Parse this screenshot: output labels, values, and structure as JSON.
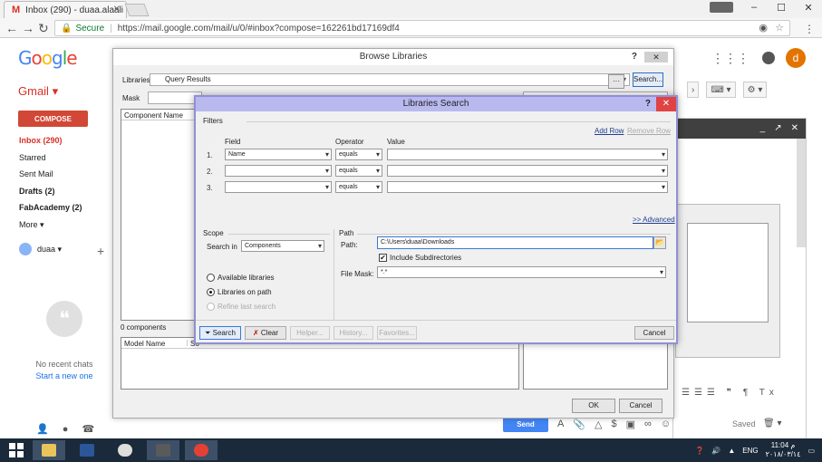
{
  "browser": {
    "tab_title": "Inbox (290) - duaa.alaali",
    "url": "https://mail.google.com/mail/u/0/#inbox?compose=162261bd17169df4",
    "secure_label": "Secure"
  },
  "gmail": {
    "logo_letters": [
      "G",
      "o",
      "o",
      "g",
      "l",
      "e"
    ],
    "product_label": "Gmail",
    "compose_label": "COMPOSE",
    "nav": [
      {
        "label": "Inbox (290)",
        "style": "active"
      },
      {
        "label": "Starred",
        "style": "normal"
      },
      {
        "label": "Sent Mail",
        "style": "normal"
      },
      {
        "label": "Drafts (2)",
        "style": "bold"
      },
      {
        "label": "FabAcademy (2)",
        "style": "bold"
      },
      {
        "label": "More",
        "style": "normal"
      }
    ],
    "user_name": "duaa",
    "avatar_letter": "d",
    "no_chats": "No recent chats",
    "start_chat": "Start a new one",
    "send_label": "Send",
    "saved_label": "Saved"
  },
  "browse": {
    "title": "Browse Libraries",
    "libraries_label": "Libraries",
    "libraries_value": "Query Results",
    "search_button": "Search...",
    "mask_label": "Mask",
    "component_name_header": "Component Name",
    "components_count": "0 components",
    "model_name_header": "Model Name",
    "model_source_header": "So",
    "ok_button": "OK",
    "cancel_button": "Cancel"
  },
  "search": {
    "title": "Libraries Search",
    "filters_label": "Filters",
    "add_row": "Add Row",
    "remove_row": "Remove Row",
    "field_header": "Field",
    "operator_header": "Operator",
    "value_header": "Value",
    "rows": [
      {
        "num": "1.",
        "field": "Name",
        "operator": "equals",
        "value": ""
      },
      {
        "num": "2.",
        "field": "",
        "operator": "equals",
        "value": ""
      },
      {
        "num": "3.",
        "field": "",
        "operator": "equals",
        "value": ""
      }
    ],
    "advanced_link": ">> Advanced",
    "scope_label": "Scope",
    "search_in_label": "Search in",
    "search_in_value": "Components",
    "options": [
      {
        "label": "Available libraries",
        "state": "off"
      },
      {
        "label": "Libraries on path",
        "state": "on"
      },
      {
        "label": "Refine last search",
        "state": "disabled"
      }
    ],
    "path_group_label": "Path",
    "path_label": "Path:",
    "path_value": "C:\\Users\\duaa\\Downloads",
    "include_subdirs": "Include Subdirectories",
    "file_mask_label": "File Mask:",
    "file_mask_value": "*.*",
    "buttons": {
      "search": "Search",
      "clear": "Clear",
      "helper": "Helper...",
      "history": "History...",
      "favorites": "Favorites...",
      "cancel": "Cancel"
    }
  },
  "taskbar": {
    "lang": "ENG",
    "time": "11:04 م",
    "date": "٢٠١٨/٠٣/١٤"
  },
  "colors": {
    "gmail_red": "#d93025",
    "compose_red": "#d14836",
    "dialog_title_purple": "#b9b9f0",
    "close_red": "#e04343",
    "taskbar": "#1b2a3a"
  }
}
